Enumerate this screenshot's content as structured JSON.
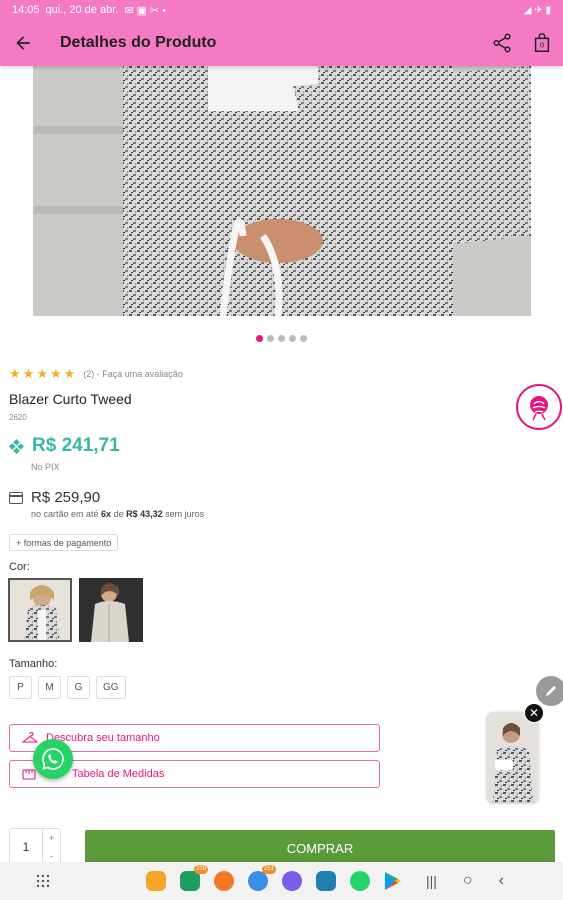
{
  "status_bar": {
    "time": "14:05",
    "date": "qui., 20 de abr.",
    "right_text": "◢ ✈ ▮"
  },
  "appbar": {
    "title": "Detalhes do Produto"
  },
  "carousel": {
    "slides": 5,
    "active": 0
  },
  "rating": {
    "stars": 5,
    "text": "(2) - Faça uma avaliação"
  },
  "product": {
    "name": "Blazer Curto Tweed",
    "sku": "2620"
  },
  "pricing": {
    "pix_price": "R$ 241,71",
    "pix_label": "No PIX",
    "card_price": "R$ 259,90",
    "card_prefix": "no cartão em até ",
    "installments": "6x",
    "card_mid": " de ",
    "installment_value": "R$ 43,32",
    "card_suffix": " sem juros"
  },
  "payment_button": "+ formas de pagamento",
  "color_label": "Cor:",
  "size_label": "Tamanho:",
  "sizes": [
    "P",
    "M",
    "G",
    "GG"
  ],
  "size_button": "Descubra seu tamanho",
  "measures_button": "Tabela de Medidas",
  "quantity": "1",
  "buy_button": "COMPRAR",
  "dock_badges": {
    "chat": "228",
    "messages": "251"
  },
  "colors": {
    "accent": "#f47bc3",
    "pink": "#e6167e",
    "pix": "#3ab5a8",
    "buy": "#5b9a3b",
    "whatsapp": "#25d366"
  }
}
